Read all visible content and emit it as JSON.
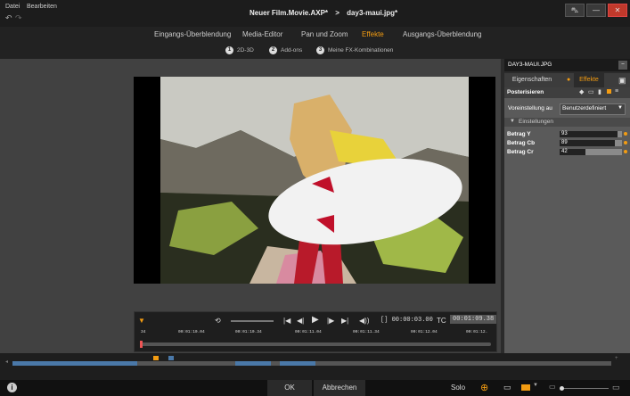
{
  "menu": {
    "file": "Datei",
    "edit": "Bearbeiten"
  },
  "title": {
    "project": "Neuer Film.Movie.AXP*",
    "separator": ">",
    "file": "day3-maui.jpg*"
  },
  "window": {
    "minimize": "—",
    "close": "✕"
  },
  "tabs": [
    {
      "label": "Eingangs-Überblendung"
    },
    {
      "label": "Media-Editor"
    },
    {
      "label": "Pan und Zoom"
    },
    {
      "label": "Effekte",
      "active": true
    },
    {
      "label": "Ausgangs-Überblendung"
    }
  ],
  "subtabs": [
    {
      "num": "1",
      "label": "2D-3D"
    },
    {
      "num": "2",
      "label": "Add-ons"
    },
    {
      "num": "3",
      "label": "Meine FX-Kombinationen"
    }
  ],
  "transport": {
    "timecode": "[] 00:00:03.00",
    "tc_label": "TC",
    "tc_value": "00:01:09.38",
    "start_marker": "34",
    "ticks": [
      "00:01:10.04",
      "00:01:10.34",
      "00:01:11.04",
      "00:01:11.34",
      "00:01:12.04",
      "00:01:12."
    ]
  },
  "right_panel": {
    "clip_name": "DAY3-MAUI.JPG",
    "tab_properties": "Eigenschaften",
    "tab_effects": "Effekte",
    "effect_name": "Posterisieren",
    "preset_label": "Voreinstellung au",
    "preset_value": "Benutzerdefiniert",
    "settings_label": "Einstellungen",
    "params": [
      {
        "label": "Betrag Y",
        "value": "93",
        "fraction": 0.93
      },
      {
        "label": "Betrag Cb",
        "value": "89",
        "fraction": 0.89
      },
      {
        "label": "Betrag Cr",
        "value": "42",
        "fraction": 0.42
      }
    ]
  },
  "bottom": {
    "ok": "OK",
    "cancel": "Abbrechen",
    "solo": "Solo"
  },
  "colors": {
    "accent": "#f39c12",
    "close": "#c0392b",
    "timeline_clip": "#4a78a8"
  }
}
